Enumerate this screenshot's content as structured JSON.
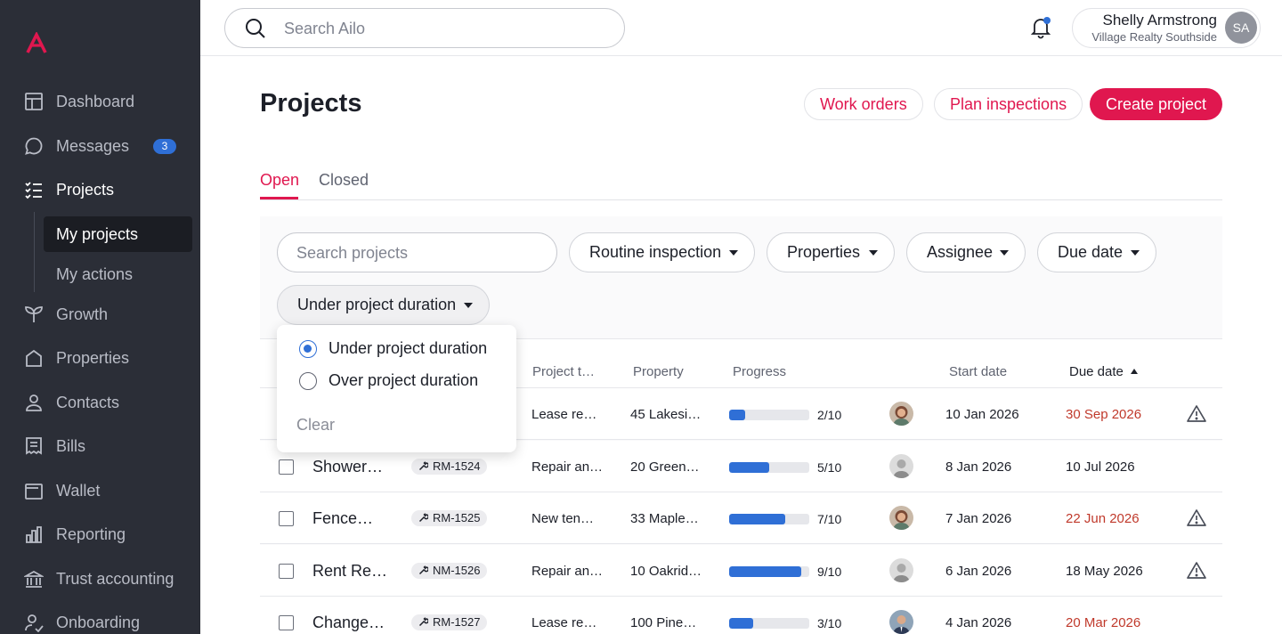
{
  "sidebar": {
    "brand_color": "#e0174f",
    "items": [
      {
        "label": "Dashboard",
        "icon": "dashboard-icon"
      },
      {
        "label": "Messages",
        "icon": "chat-bubble-icon",
        "badge": "3"
      },
      {
        "label": "Projects",
        "icon": "checklist-icon",
        "active": true
      },
      {
        "label": "Growth",
        "icon": "plant-icon"
      },
      {
        "label": "Properties",
        "icon": "house-icon"
      },
      {
        "label": "Contacts",
        "icon": "person-icon"
      },
      {
        "label": "Bills",
        "icon": "receipt-icon"
      },
      {
        "label": "Wallet",
        "icon": "wallet-icon"
      },
      {
        "label": "Reporting",
        "icon": "bar-chart-icon"
      },
      {
        "label": "Trust accounting",
        "icon": "bank-icon"
      },
      {
        "label": "Onboarding",
        "icon": "onboarding-icon"
      }
    ],
    "sub_items": [
      {
        "label": "My projects",
        "active": true
      },
      {
        "label": "My actions"
      }
    ]
  },
  "topbar": {
    "search_placeholder": "Search Ailo",
    "user_name": "Shelly Armstrong",
    "user_org": "Village Realty Southside",
    "user_initials": "SA"
  },
  "page": {
    "title": "Projects",
    "work_orders_label": "Work orders",
    "plan_inspections_label": "Plan inspections",
    "create_project_label": "Create project",
    "tabs": [
      {
        "label": "Open",
        "active": true
      },
      {
        "label": "Closed"
      }
    ]
  },
  "filters": {
    "search_placeholder": "Search projects",
    "routine_inspection": "Routine inspection",
    "properties": "Properties",
    "assignee": "Assignee",
    "due_date": "Due date",
    "duration": "Under project duration"
  },
  "dropdown": {
    "options": [
      {
        "label": "Under project duration",
        "selected": true
      },
      {
        "label": "Over project duration",
        "selected": false
      }
    ],
    "clear_label": "Clear"
  },
  "table": {
    "headers": {
      "project_type": "Project t…",
      "property": "Property",
      "progress": "Progress",
      "start_date": "Start date",
      "due_date": "Due date"
    },
    "rows": [
      {
        "name": "",
        "ref": "",
        "type": "Lease re…",
        "property": "45 Lakesi…",
        "progress": 0.2,
        "progress_text": "2/10",
        "start": "10 Jan 2026",
        "due": "30 Sep 2026",
        "due_late": true,
        "warning": true,
        "assignee": "female"
      },
      {
        "name": "Shower…",
        "ref": "RM-1524",
        "type": "Repair an…",
        "property": "20 Green…",
        "progress": 0.5,
        "progress_text": "5/10",
        "start": "8 Jan 2026",
        "due": "10 Jul 2026",
        "due_late": false,
        "warning": false,
        "assignee": "male-grey"
      },
      {
        "name": "Fence…",
        "ref": "RM-1525",
        "type": "New ten…",
        "property": "33 Maple…",
        "progress": 0.7,
        "progress_text": "7/10",
        "start": "7 Jan 2026",
        "due": "22 Jun 2026",
        "due_late": true,
        "warning": true,
        "assignee": "female"
      },
      {
        "name": "Rent Re…",
        "ref": "NM-1526",
        "type": "Repair an…",
        "property": "10 Oakrid…",
        "progress": 0.9,
        "progress_text": "9/10",
        "start": "6 Jan 2026",
        "due": "18 May 2026",
        "due_late": false,
        "warning": true,
        "assignee": "male-grey"
      },
      {
        "name": "Change…",
        "ref": "RM-1527",
        "type": "Lease re…",
        "property": "100 Pine…",
        "progress": 0.3,
        "progress_text": "3/10",
        "start": "4 Jan 2026",
        "due": "20 Mar 2026",
        "due_late": true,
        "warning": false,
        "assignee": "male-suit"
      }
    ]
  }
}
